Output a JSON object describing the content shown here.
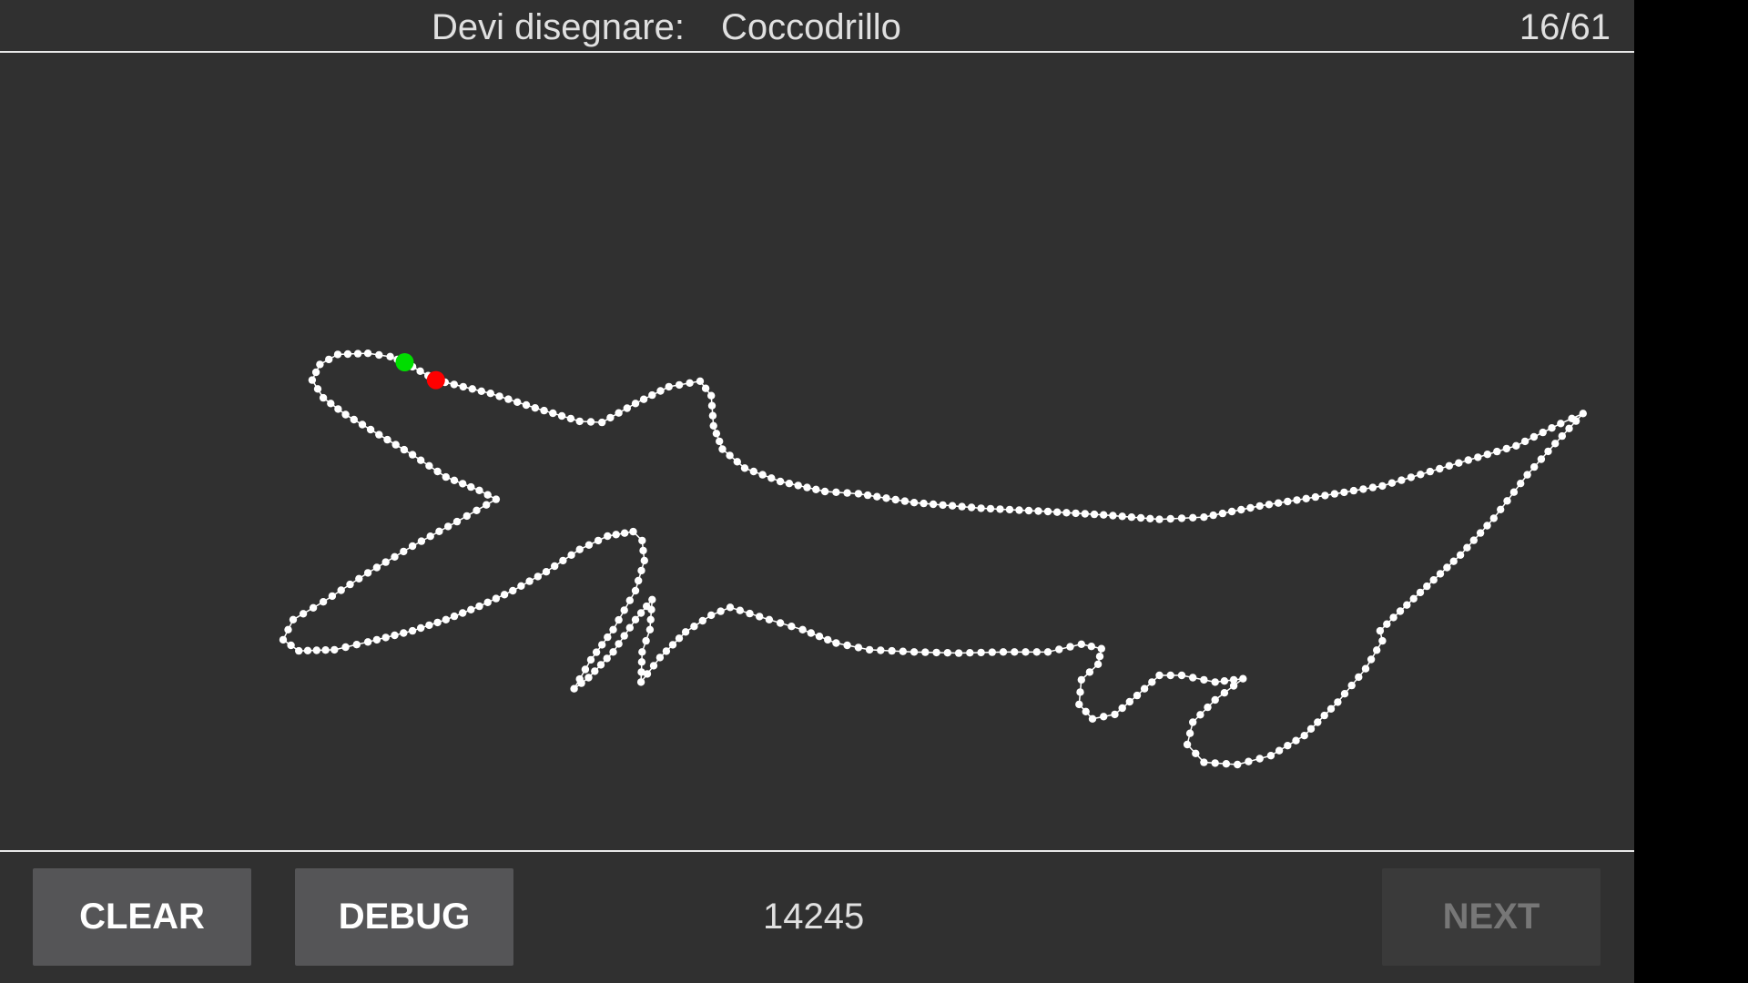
{
  "header": {
    "prompt_label": "Devi disegnare:",
    "prompt_word": "Coccodrillo",
    "progress": "16/61"
  },
  "canvas": {
    "stroke_color": "#ffffff",
    "start_point_color": "#00dd00",
    "end_point_color": "#ff0000"
  },
  "footer": {
    "clear_label": "CLEAR",
    "debug_label": "DEBUG",
    "score": "14245",
    "next_label": "NEXT"
  }
}
